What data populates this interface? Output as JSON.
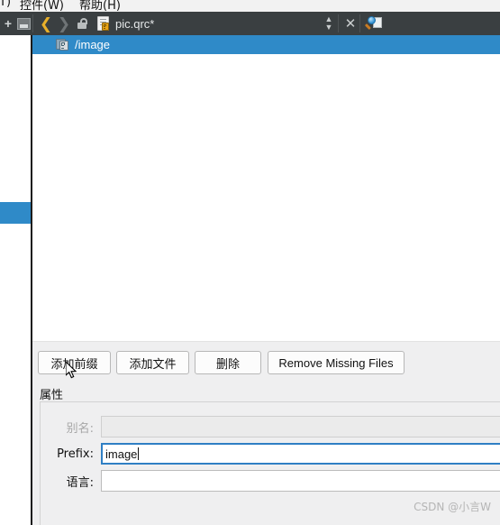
{
  "menubar": {
    "items": [
      {
        "label": "(T)"
      },
      {
        "label": "控件(W)"
      },
      {
        "label": "帮助(H)"
      }
    ]
  },
  "toolbar": {
    "split_icon": "plus-icon",
    "pane_icon": "panel-icon",
    "back_icon": "back-arrow-icon",
    "forward_icon": "forward-arrow-icon",
    "lock_icon": "unlock-icon",
    "file_icon": "qrc-file-icon",
    "filename": "pic.qrc*",
    "split_view_icon": "split-vertical-icon",
    "close_icon": "close-icon",
    "search_icon": "magnifier-document-icon"
  },
  "tree": {
    "rows": [
      {
        "label": "/image",
        "icon": "resource-prefix-icon",
        "selected": true
      }
    ]
  },
  "buttons": [
    {
      "label": "添加前缀",
      "name": "add-prefix-button"
    },
    {
      "label": "添加文件",
      "name": "add-files-button"
    },
    {
      "label": "删除",
      "name": "remove-button"
    },
    {
      "label": "Remove Missing Files",
      "name": "remove-missing-files-button"
    }
  ],
  "properties": {
    "caption": "属性",
    "fields": [
      {
        "label": "别名:",
        "value": "",
        "placeholder": "",
        "disabled": true,
        "focused": false
      },
      {
        "label": "Prefix:",
        "value": "image",
        "placeholder": "",
        "disabled": false,
        "focused": true
      },
      {
        "label": "语言:",
        "value": "",
        "placeholder": "",
        "disabled": false,
        "focused": false
      }
    ]
  },
  "watermark": {
    "text": "CSDN @小言W"
  },
  "colors": {
    "toolbar_bg": "#3a3f41",
    "selection_blue": "#2f8ac8",
    "focus_blue": "#2f7fc4",
    "panel_bg": "#efeff0",
    "accent_yellow": "#e8b02a"
  }
}
